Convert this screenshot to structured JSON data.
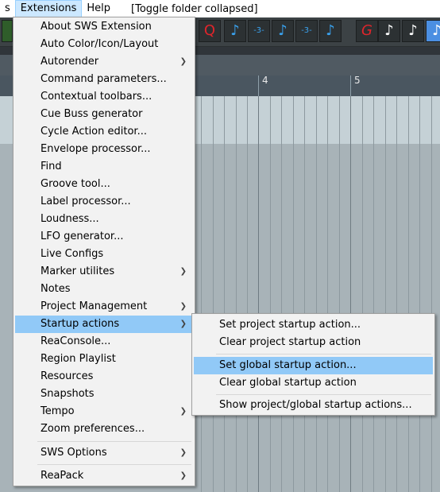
{
  "menubar": {
    "items": [
      {
        "label": "s",
        "active": false
      },
      {
        "label": "Extensions",
        "active": true
      },
      {
        "label": "Help",
        "active": false
      }
    ],
    "title": "[Toggle folder collapsed]"
  },
  "ruler": {
    "labels": [
      "4",
      "5"
    ]
  },
  "toolbar": {
    "buttons": [
      {
        "icon": "quantize-icon",
        "glyph": "Q"
      },
      {
        "icon": "eighth-note-icon",
        "glyph": "♪"
      },
      {
        "icon": "triplet-icon",
        "glyph": "-3-"
      },
      {
        "icon": "eighth-note-icon",
        "glyph": "♪"
      },
      {
        "icon": "triplet-icon",
        "glyph": "-3-"
      },
      {
        "icon": "eighth-note-icon",
        "glyph": "♪"
      },
      {
        "icon": "grid-icon",
        "glyph": "G"
      },
      {
        "icon": "quarter-note-icon",
        "glyph": "♪"
      },
      {
        "icon": "triplet-note-icon",
        "glyph": "♪"
      },
      {
        "icon": "note-selected-icon",
        "glyph": "♪"
      }
    ]
  },
  "extensions_menu": {
    "items": [
      {
        "label": "About SWS Extension",
        "submenu": false
      },
      {
        "label": "Auto Color/Icon/Layout",
        "submenu": false
      },
      {
        "label": "Autorender",
        "submenu": true
      },
      {
        "label": "Command parameters...",
        "submenu": false
      },
      {
        "label": "Contextual toolbars...",
        "submenu": false
      },
      {
        "label": "Cue Buss generator",
        "submenu": false
      },
      {
        "label": "Cycle Action editor...",
        "submenu": false
      },
      {
        "label": "Envelope processor...",
        "submenu": false
      },
      {
        "label": "Find",
        "submenu": false
      },
      {
        "label": "Groove tool...",
        "submenu": false
      },
      {
        "label": "Label processor...",
        "submenu": false
      },
      {
        "label": "Loudness...",
        "submenu": false
      },
      {
        "label": "LFO generator...",
        "submenu": false
      },
      {
        "label": "Live Configs",
        "submenu": false
      },
      {
        "label": "Marker utilites",
        "submenu": true
      },
      {
        "label": "Notes",
        "submenu": false
      },
      {
        "label": "Project Management",
        "submenu": true
      },
      {
        "label": "Startup actions",
        "submenu": true,
        "highlighted": true
      },
      {
        "label": "ReaConsole...",
        "submenu": false
      },
      {
        "label": "Region Playlist",
        "submenu": false
      },
      {
        "label": "Resources",
        "submenu": false
      },
      {
        "label": "Snapshots",
        "submenu": false
      },
      {
        "label": "Tempo",
        "submenu": true
      },
      {
        "label": "Zoom preferences...",
        "submenu": false
      }
    ],
    "after_sep1": [
      {
        "label": "SWS Options",
        "submenu": true
      }
    ],
    "after_sep2": [
      {
        "label": "ReaPack",
        "submenu": true
      }
    ]
  },
  "startup_submenu": {
    "items": [
      {
        "label": "Set project startup action..."
      },
      {
        "label": "Clear project startup action"
      }
    ],
    "group2": [
      {
        "label": "Set global startup action...",
        "highlighted": true
      },
      {
        "label": "Clear global startup action"
      }
    ],
    "group3": [
      {
        "label": "Show project/global startup actions..."
      }
    ]
  },
  "colors": {
    "menu_bg": "#f2f2f2",
    "highlight": "#91c9f7",
    "menubar_active": "#cce8ff"
  }
}
